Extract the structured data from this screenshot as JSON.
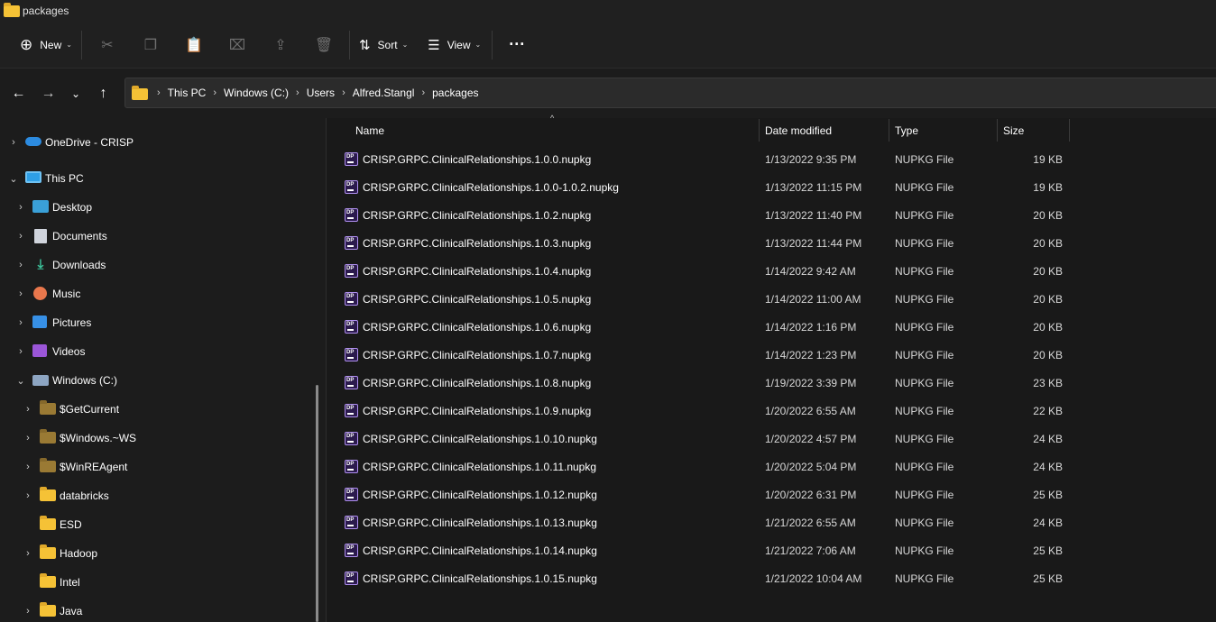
{
  "window": {
    "title": "packages"
  },
  "toolbar": {
    "new_label": "New",
    "sort_label": "Sort",
    "view_label": "View",
    "more_label": "···"
  },
  "breadcrumb": [
    "This PC",
    "Windows (C:)",
    "Users",
    "Alfred.Stangl",
    "packages"
  ],
  "sidebar": {
    "onedrive": "OneDrive - CRISP",
    "this_pc": "This PC",
    "desktop": "Desktop",
    "documents": "Documents",
    "downloads": "Downloads",
    "music": "Music",
    "pictures": "Pictures",
    "videos": "Videos",
    "windows_c": "Windows (C:)",
    "getcurrent": "$GetCurrent",
    "windows_ws": "$Windows.~WS",
    "winreagent": "$WinREAgent",
    "databricks": "databricks",
    "esd": "ESD",
    "hadoop": "Hadoop",
    "intel": "Intel",
    "java": "Java"
  },
  "columns": {
    "name": "Name",
    "date": "Date modified",
    "type": "Type",
    "size": "Size"
  },
  "files": [
    {
      "name": "CRISP.GRPC.ClinicalRelationships.1.0.0.nupkg",
      "date": "1/13/2022 9:35 PM",
      "type": "NUPKG File",
      "size": "19 KB"
    },
    {
      "name": "CRISP.GRPC.ClinicalRelationships.1.0.0-1.0.2.nupkg",
      "date": "1/13/2022 11:15 PM",
      "type": "NUPKG File",
      "size": "19 KB"
    },
    {
      "name": "CRISP.GRPC.ClinicalRelationships.1.0.2.nupkg",
      "date": "1/13/2022 11:40 PM",
      "type": "NUPKG File",
      "size": "20 KB"
    },
    {
      "name": "CRISP.GRPC.ClinicalRelationships.1.0.3.nupkg",
      "date": "1/13/2022 11:44 PM",
      "type": "NUPKG File",
      "size": "20 KB"
    },
    {
      "name": "CRISP.GRPC.ClinicalRelationships.1.0.4.nupkg",
      "date": "1/14/2022 9:42 AM",
      "type": "NUPKG File",
      "size": "20 KB"
    },
    {
      "name": "CRISP.GRPC.ClinicalRelationships.1.0.5.nupkg",
      "date": "1/14/2022 11:00 AM",
      "type": "NUPKG File",
      "size": "20 KB"
    },
    {
      "name": "CRISP.GRPC.ClinicalRelationships.1.0.6.nupkg",
      "date": "1/14/2022 1:16 PM",
      "type": "NUPKG File",
      "size": "20 KB"
    },
    {
      "name": "CRISP.GRPC.ClinicalRelationships.1.0.7.nupkg",
      "date": "1/14/2022 1:23 PM",
      "type": "NUPKG File",
      "size": "20 KB"
    },
    {
      "name": "CRISP.GRPC.ClinicalRelationships.1.0.8.nupkg",
      "date": "1/19/2022 3:39 PM",
      "type": "NUPKG File",
      "size": "23 KB"
    },
    {
      "name": "CRISP.GRPC.ClinicalRelationships.1.0.9.nupkg",
      "date": "1/20/2022 6:55 AM",
      "type": "NUPKG File",
      "size": "22 KB"
    },
    {
      "name": "CRISP.GRPC.ClinicalRelationships.1.0.10.nupkg",
      "date": "1/20/2022 4:57 PM",
      "type": "NUPKG File",
      "size": "24 KB"
    },
    {
      "name": "CRISP.GRPC.ClinicalRelationships.1.0.11.nupkg",
      "date": "1/20/2022 5:04 PM",
      "type": "NUPKG File",
      "size": "24 KB"
    },
    {
      "name": "CRISP.GRPC.ClinicalRelationships.1.0.12.nupkg",
      "date": "1/20/2022 6:31 PM",
      "type": "NUPKG File",
      "size": "25 KB"
    },
    {
      "name": "CRISP.GRPC.ClinicalRelationships.1.0.13.nupkg",
      "date": "1/21/2022 6:55 AM",
      "type": "NUPKG File",
      "size": "24 KB"
    },
    {
      "name": "CRISP.GRPC.ClinicalRelationships.1.0.14.nupkg",
      "date": "1/21/2022 7:06 AM",
      "type": "NUPKG File",
      "size": "25 KB"
    },
    {
      "name": "CRISP.GRPC.ClinicalRelationships.1.0.15.nupkg",
      "date": "1/21/2022 10:04 AM",
      "type": "NUPKG File",
      "size": "25 KB"
    }
  ],
  "file_icon_label": "DP"
}
